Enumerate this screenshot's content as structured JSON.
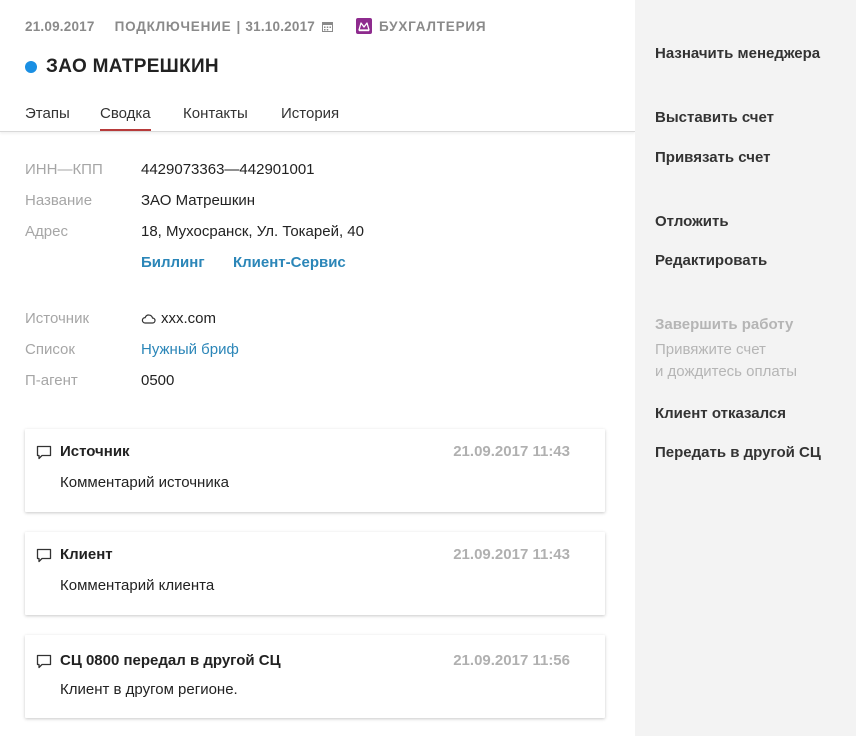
{
  "header": {
    "date": "21.09.2017",
    "status_label": "ПОДКЛЮЧЕНИЕ",
    "status_separator": "|",
    "status_date": "31.10.2017",
    "department": "БУХГАЛТЕРИЯ",
    "dot_color": "#1a8fe3",
    "company_name": "ЗАО МАТРЕШКИН"
  },
  "tabs": [
    {
      "label": "Этапы"
    },
    {
      "label": "Сводка",
      "active": true
    },
    {
      "label": "Контакты"
    },
    {
      "label": "История"
    }
  ],
  "details": {
    "inn_label": "ИНН—КПП",
    "inn_value": "4429073363—442901001",
    "name_label": "Название",
    "name_value": "ЗАО Матрешкин",
    "address_label": "Адрес",
    "address_value": "18, Мухосранск, Ул. Токарей, 40",
    "link_billing": "Биллинг",
    "link_client_service": "Клиент-Сервис",
    "source_label": "Источник",
    "source_value": "xxx.com",
    "list_label": "Список",
    "list_value": "Нужный бриф",
    "agent_label": "П-агент",
    "agent_value": "0500"
  },
  "comments": [
    {
      "title": "Источник",
      "time": "21.09.2017 11:43",
      "text": "Комментарий источника"
    },
    {
      "title": "Клиент",
      "time": "21.09.2017 11:43",
      "text": "Комментарий клиента"
    },
    {
      "title": "СЦ 0800 передал в другой СЦ",
      "time": "21.09.2017 11:56",
      "text": "Клиент в другом регионе."
    }
  ],
  "sidebar": {
    "assign_manager": "Назначить менеджера",
    "issue_invoice": "Выставить счет",
    "attach_invoice": "Привязать счет",
    "postpone": "Отложить",
    "edit": "Редактировать",
    "finish_work": "Завершить работу",
    "finish_hint_line1": "Привяжите счет",
    "finish_hint_line2": "и дождитесь оплаты",
    "client_refused": "Клиент отказался",
    "transfer": "Передать в другой СЦ"
  },
  "colors": {
    "accent_tab": "#b73a3a",
    "link": "#2b86b8",
    "department_icon": "#8e2b8e"
  }
}
